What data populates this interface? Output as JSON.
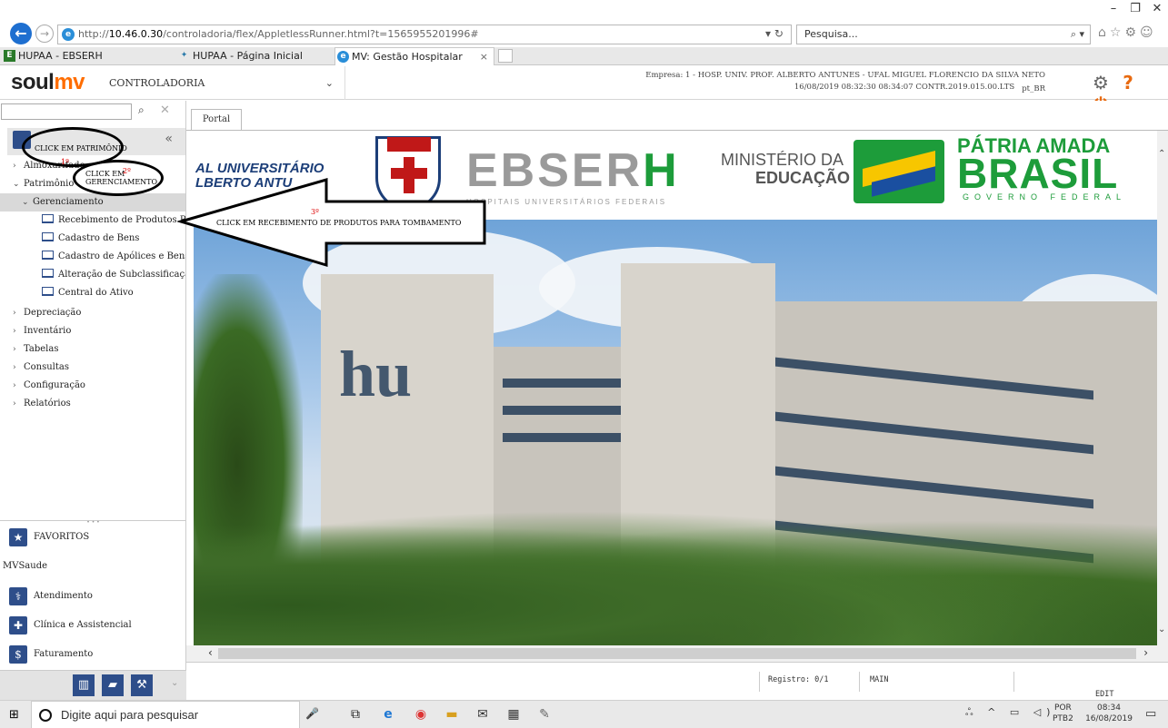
{
  "window": {
    "minimize": "–",
    "restore": "❐",
    "close": "✕"
  },
  "browser": {
    "url_prefix": "http://",
    "url_host": "10.46.0.30",
    "url_path": "/controladoria/flex/AppletlessRunner.html?t=1565955201996#",
    "search_placeholder": "Pesquisa...",
    "tabs": [
      {
        "label": "HUPAA - EBSERH",
        "active": false
      },
      {
        "label": "HUPAA - Página Inicial",
        "active": false
      },
      {
        "label": "MV: Gestão Hospitalar",
        "active": true
      }
    ]
  },
  "app": {
    "logo_soul": "soul",
    "logo_mv": "mv",
    "module": "CONTROLADORIA",
    "company_line1": "Empresa: 1 - HOSP. UNIV. PROF. ALBERTO ANTUNES - UFAL   MIGUEL FLORENCIO DA SILVA NETO",
    "company_line2": "16/08/2019 08:32:30   08:34:07   CONTR.2019.015.00.LTS",
    "locale": "pt_BR"
  },
  "sidebar": {
    "menu": [
      {
        "label": "Almoxarifado",
        "arrow": "›",
        "level": 0
      },
      {
        "label": "Patrimônio",
        "arrow": "⌄",
        "level": 0
      },
      {
        "label": "Gerenciamento",
        "arrow": "⌄",
        "level": 1
      },
      {
        "label": "Recebimento de Produtos Para Tombamento",
        "level": 2
      },
      {
        "label": "Cadastro de Bens",
        "level": 2
      },
      {
        "label": "Cadastro de Apólices e Bens Segurados",
        "level": 2
      },
      {
        "label": "Alteração de Subclassificação de Bens",
        "level": 2
      },
      {
        "label": "Central do Ativo",
        "level": 2
      },
      {
        "label": "Depreciação",
        "arrow": "›",
        "level": 0
      },
      {
        "label": "Inventário",
        "arrow": "›",
        "level": 0
      },
      {
        "label": "Tabelas",
        "arrow": "›",
        "level": 0
      },
      {
        "label": "Consultas",
        "arrow": "›",
        "level": 0
      },
      {
        "label": "Configuração",
        "arrow": "›",
        "level": 0
      },
      {
        "label": "Relatórios",
        "arrow": "›",
        "level": 0
      }
    ],
    "favoritos": "FAVORITOS",
    "group": "MVSaude",
    "modules": [
      "Atendimento",
      "Clínica e Assistencial",
      "Faturamento"
    ]
  },
  "content": {
    "tab": "Portal",
    "banner": {
      "huniv_line1": "AL UNIVERSITÁRIO",
      "huniv_line2": "LBERTO ANTU",
      "ebserh": "EBSERH",
      "ebserh_sub": "HOSPITAIS UNIVERSITÁRIOS FEDERAIS",
      "mec_line1": "MINISTÉRIO DA",
      "mec_line2": "EDUCAÇÃO",
      "patria": "PÁTRIA AMADA",
      "brasil": "BRASIL",
      "gov": "GOVERNO FEDERAL"
    }
  },
  "status": {
    "registro": "Registro: 0/1",
    "mode": "MAIN",
    "edit": "EDIT"
  },
  "annotations": {
    "a1": "CLICK EM PATRIMÔNIO",
    "a1_num": "1º",
    "a2_line1": "CLICK EM",
    "a2_num": "2º",
    "a2_line2": "GERENCIAMENTO",
    "a3_num": "3º",
    "a3": "CLICK EM RECEBIMENTO DE PRODUTOS PARA TOMBAMENTO"
  },
  "taskbar": {
    "search": "Digite aqui para pesquisar",
    "lang1": "POR",
    "lang2": "PTB2",
    "time": "08:34",
    "date": "16/08/2019"
  }
}
